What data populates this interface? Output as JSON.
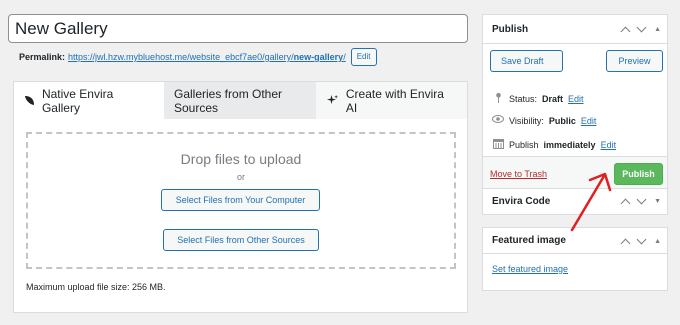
{
  "title_field": {
    "value": "New Gallery"
  },
  "permalink": {
    "label": "Permalink:",
    "url_prefix": "https://jwl.hzw.mybluehost.me/website_ebcf7ae0/gallery/",
    "slug": "new-gallery",
    "url_suffix": "/",
    "edit_label": "Edit"
  },
  "tabs": [
    {
      "label": "Native Envira Gallery",
      "icon": "envira-leaf-icon"
    },
    {
      "label": "Galleries from Other Sources"
    },
    {
      "label": "Create with Envira AI",
      "icon": "sparkle-icon"
    }
  ],
  "upload": {
    "drop_text": "Drop files to upload",
    "or_text": "or",
    "select_computer": "Select Files from Your Computer",
    "select_other": "Select Files from Other Sources",
    "max_size": "Maximum upload file size: 256 MB."
  },
  "publish_box": {
    "title": "Publish",
    "save_draft": "Save Draft",
    "preview": "Preview",
    "status_label": "Status:",
    "status_value": "Draft",
    "visibility_label": "Visibility:",
    "visibility_value": "Public",
    "publish_label": "Publish",
    "publish_value": "immediately",
    "edit_link": "Edit",
    "move_to_trash": "Move to Trash",
    "publish_button": "Publish"
  },
  "envira_code_box": {
    "title": "Envira Code"
  },
  "featured_image_box": {
    "title": "Featured image",
    "set_link": "Set featured image"
  },
  "colors": {
    "accent": "#2271b1",
    "publish_green": "#5cb85c",
    "trash_red": "#b32d2e",
    "annotation_red": "#e02020"
  }
}
